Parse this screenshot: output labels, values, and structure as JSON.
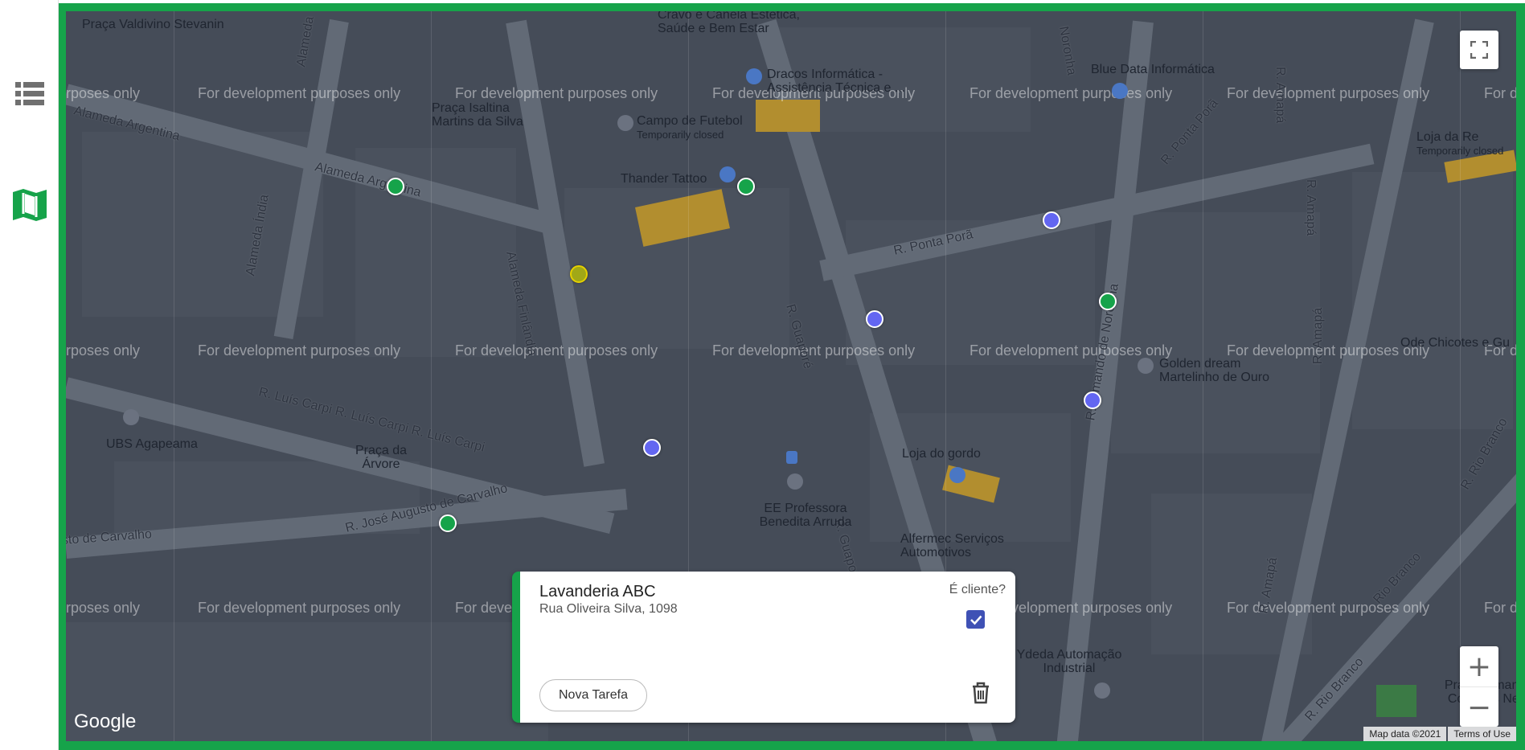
{
  "sidebar": {
    "items": [
      {
        "name": "list-view",
        "icon": "list-icon"
      },
      {
        "name": "map-view",
        "icon": "map-icon",
        "active": true
      }
    ],
    "accent": "#16a34a"
  },
  "map": {
    "watermark": "For development purposes only",
    "watermark_partial_left": "urposes only",
    "watermark_partial_right": "For d",
    "streets": [
      "Alameda Argentina",
      "Alameda Argentina",
      "Alameda Índia",
      "Alameda Finlândia",
      "R. Luís Carpi R. Luís Carpi R. Luís Carpi",
      "R. José Augusto de Carvalho",
      "sto de Carvalho",
      "R. Guaporé",
      "R. Guapo",
      "R. Ponta Porã",
      "R. Ponta Porã",
      "R. Armando de Noronha",
      "Noronha",
      "R. Amapá",
      "R. Amapá",
      "R. Amapá",
      "R. Amapá",
      "R. Rio Branco",
      "R. Rio Branco",
      "Rio Branco",
      "Alameda"
    ],
    "places": [
      {
        "name": "Praça Valdivino Stevanin"
      },
      {
        "name": "Cravo e Canela Estética, Saúde e Bem Estar"
      },
      {
        "name": "Dracos Informática - Assistência Técnica e ..."
      },
      {
        "name": "Blue Data Informática"
      },
      {
        "name": "Praça Isaltina Martins da Silva"
      },
      {
        "name": "Campo de Futebol",
        "sub": "Temporarily closed"
      },
      {
        "name": "Thander Tattoo"
      },
      {
        "name": "Loja da Re",
        "sub": "Temporarily closed"
      },
      {
        "name": "Golden dream Martelinho de Ouro"
      },
      {
        "name": "Ode Chicotes e Gu"
      },
      {
        "name": "UBS Agapeama"
      },
      {
        "name": "Praça da Árvore"
      },
      {
        "name": "Loja do gordo"
      },
      {
        "name": "EE Professora Benedita Arruda"
      },
      {
        "name": "Alfermec Serviços Automotivos"
      },
      {
        "name": "Ydeda Automação Industrial"
      },
      {
        "name": "Praça Armando Cobeiras Neto"
      }
    ],
    "markers": [
      {
        "color": "#16a34a"
      },
      {
        "color": "#16a34a"
      },
      {
        "color": "#a1a817"
      },
      {
        "color": "#6366f1"
      },
      {
        "color": "#6366f1"
      },
      {
        "color": "#16a34a"
      },
      {
        "color": "#6366f1"
      },
      {
        "color": "#6366f1"
      },
      {
        "color": "#16a34a"
      }
    ],
    "google_logo": "Google",
    "attribution": {
      "data": "Map data ©2021",
      "terms": "Terms of Use"
    },
    "zoom_in": "+",
    "zoom_out": "−"
  },
  "card": {
    "title": "Lavanderia ABC",
    "address": "Rua Oliveira Silva, 1098",
    "client_question": "É cliente?",
    "is_client": true,
    "new_task_label": "Nova Tarefa",
    "accent": "#16a34a",
    "checkbox_color": "#3f51b5"
  }
}
